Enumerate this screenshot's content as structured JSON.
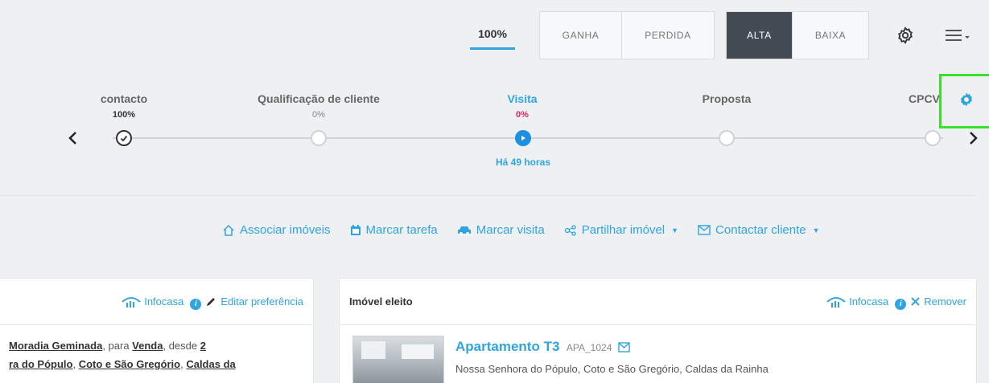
{
  "toolbar": {
    "percent_tab": "100%",
    "outcome_group": [
      "GANHA",
      "PERDIDA"
    ],
    "priority_group": [
      "ALTA",
      "BAIXA"
    ],
    "priority_active": "ALTA",
    "icons": [
      "gear-outline-icon",
      "menu-lines-icon"
    ]
  },
  "pipeline": {
    "stages": [
      {
        "name": "contacto",
        "percent": "100%"
      },
      {
        "name": "Qualificação de cliente",
        "percent": "0%"
      },
      {
        "name": "Visita",
        "percent": "0%",
        "since": "Há 49 horas"
      },
      {
        "name": "Proposta",
        "percent": ""
      },
      {
        "name": "CPCV",
        "percent": ""
      }
    ],
    "active_stage": "Visita"
  },
  "actions": [
    {
      "label": "Associar imóveis",
      "icon": "home-icon"
    },
    {
      "label": "Marcar tarefa",
      "icon": "calendar-icon"
    },
    {
      "label": "Marcar visita",
      "icon": "car-icon"
    },
    {
      "label": "Partilhar imóvel",
      "icon": "share-icon",
      "dropdown": true
    },
    {
      "label": "Contactar cliente",
      "icon": "envelope-icon",
      "dropdown": true
    }
  ],
  "preferences_panel": {
    "infocasa": "Infocasa",
    "edit_label": "Editar preferência",
    "line1": {
      "t1": "Moradia Geminada",
      "t2": ", para ",
      "t3": "Venda",
      "t4": ", desde ",
      "t5": "2"
    },
    "line2": {
      "t1": "ra do Pópulo",
      "t2": ", ",
      "t3": "Coto e São Gregório",
      "t4": ", ",
      "t5": "Caldas da"
    }
  },
  "elected_panel": {
    "title": "Imóvel eleito",
    "infocasa": "Infocasa",
    "remove_label": "Remover",
    "property": {
      "title": "Apartamento T3",
      "ref": "APA_1024",
      "location": "Nossa Senhora do Pópulo, Coto e São Gregório, Caldas da Rainha"
    }
  },
  "colors": {
    "accent": "#2ea5e0",
    "active_dark": "#434a54",
    "pink": "#e0245e",
    "highlight": "#39e02a"
  }
}
